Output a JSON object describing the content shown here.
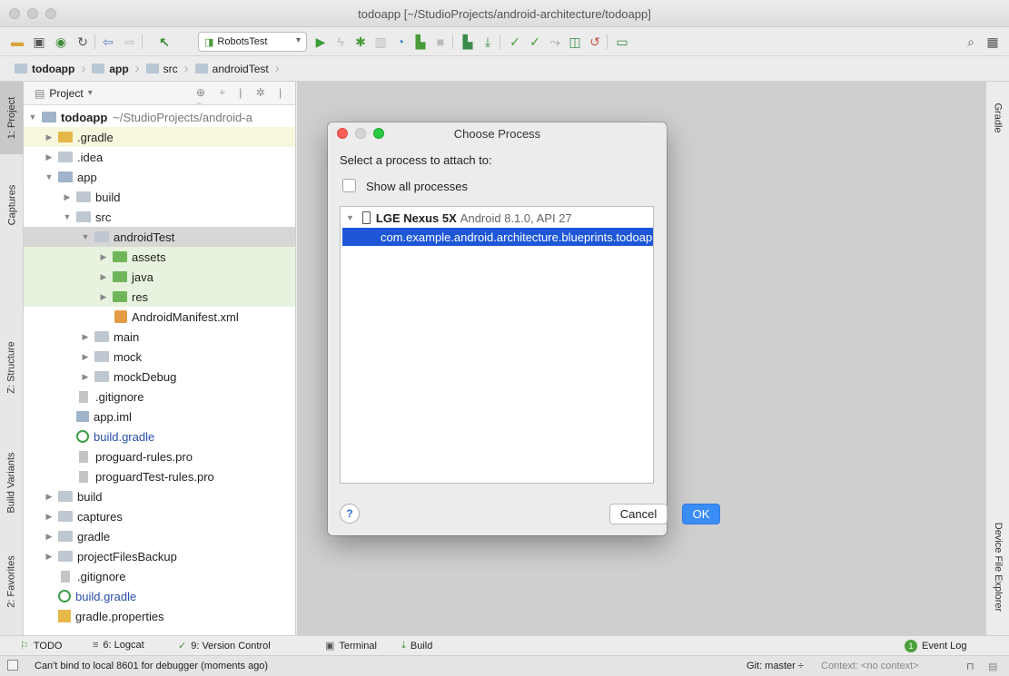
{
  "window": {
    "title": "todoapp [~/StudioProjects/android-architecture/todoapp]"
  },
  "toolbar": {
    "run_config": "RobotsTest"
  },
  "breadcrumb": [
    "todoapp",
    "app",
    "src",
    "androidTest"
  ],
  "left_tabs": [
    "1: Project",
    "Captures",
    "Z: Structure",
    "Build Variants",
    "2: Favorites"
  ],
  "right_tabs": [
    "Gradle",
    "Device File Explorer"
  ],
  "project_panel": {
    "view_label": "Project"
  },
  "tree": [
    {
      "label": "todoapp",
      "sub": "~/StudioProjects/android-a"
    },
    {
      "label": ".gradle"
    },
    {
      "label": ".idea"
    },
    {
      "label": "app"
    },
    {
      "label": "build"
    },
    {
      "label": "src"
    },
    {
      "label": "androidTest"
    },
    {
      "label": "assets"
    },
    {
      "label": "java"
    },
    {
      "label": "res"
    },
    {
      "label": "AndroidManifest.xml"
    },
    {
      "label": "main"
    },
    {
      "label": "mock"
    },
    {
      "label": "mockDebug"
    },
    {
      "label": ".gitignore"
    },
    {
      "label": "app.iml"
    },
    {
      "label": "build.gradle"
    },
    {
      "label": "proguard-rules.pro"
    },
    {
      "label": "proguardTest-rules.pro"
    },
    {
      "label": "build"
    },
    {
      "label": "captures"
    },
    {
      "label": "gradle"
    },
    {
      "label": "projectFilesBackup"
    },
    {
      "label": ".gitignore"
    },
    {
      "label": "build.gradle"
    },
    {
      "label": "gradle.properties"
    }
  ],
  "dialog": {
    "title": "Choose Process",
    "prompt": "Select a process to attach to:",
    "show_all_label": "Show all processes",
    "device_name": "LGE Nexus 5X",
    "device_version": "Android 8.1.0, API 27",
    "process": "com.example.android.architecture.blueprints.todoapp.m",
    "help_label": "?",
    "cancel_label": "Cancel",
    "ok_label": "OK"
  },
  "bottom_tabs": [
    "TODO",
    "6: Logcat",
    "9: Version Control",
    "Terminal",
    "Build"
  ],
  "event_log": {
    "label": "Event Log",
    "count": "1"
  },
  "status": {
    "message": "Can't bind to local 8601 for debugger (moments ago)",
    "git": "Git: master ÷",
    "context": "Context: <no context>"
  }
}
